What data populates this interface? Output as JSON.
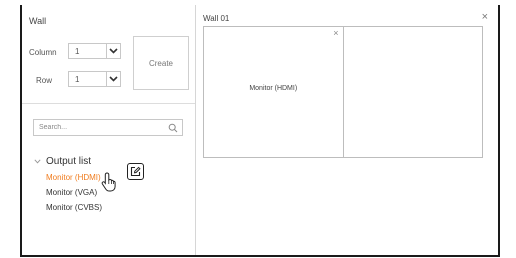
{
  "left_panel": {
    "title": "Wall",
    "column": {
      "label": "Column",
      "value": "1"
    },
    "row": {
      "label": "Row",
      "value": "1"
    },
    "create_label": "Create",
    "search": {
      "placeholder": "Search..."
    },
    "output_list": {
      "title": "Output list",
      "items": [
        {
          "label": "Monitor (HDMI)",
          "selected": true
        },
        {
          "label": "Monitor (VGA)",
          "selected": false
        },
        {
          "label": "Monitor (CVBS)",
          "selected": false
        }
      ]
    }
  },
  "wall_view": {
    "title": "Wall 01",
    "close_glyph": "×",
    "cells": [
      {
        "label": "Monitor (HDMI)",
        "close_glyph": "×"
      },
      {
        "label": ""
      }
    ]
  },
  "colors": {
    "selected_item": "#f07c1e",
    "border": "#c8c8c8"
  }
}
